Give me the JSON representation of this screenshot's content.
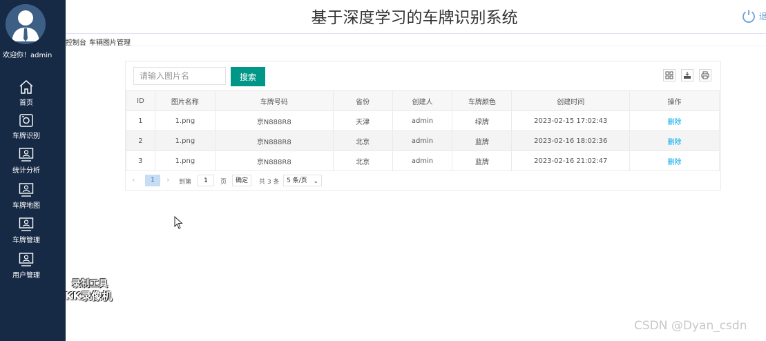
{
  "app": {
    "title": "基于深度学习的车牌识别系统",
    "welcome": "欢迎你！admin",
    "logout_text": "退"
  },
  "sidebar": {
    "items": [
      {
        "label": "首页",
        "icon": "home-icon"
      },
      {
        "label": "车牌识别",
        "icon": "camera-icon"
      },
      {
        "label": "统计分析",
        "icon": "monitor-user-icon"
      },
      {
        "label": "车牌地图",
        "icon": "monitor-user-icon"
      },
      {
        "label": "车牌管理",
        "icon": "monitor-user-icon"
      },
      {
        "label": "用户管理",
        "icon": "monitor-user-icon"
      }
    ]
  },
  "breadcrumb": [
    "控制台",
    "车辆图片管理"
  ],
  "search": {
    "placeholder": "请输入图片名",
    "button": "搜索"
  },
  "toolbar": [
    "columns-icon",
    "export-icon",
    "print-icon"
  ],
  "table": {
    "columns": [
      "ID",
      "图片名称",
      "车牌号码",
      "省份",
      "创建人",
      "车牌颜色",
      "创建时间",
      "操作"
    ],
    "rows": [
      {
        "id": "1",
        "name": "1.png",
        "plate": "京N888R8",
        "province": "天津",
        "creator": "admin",
        "color": "绿牌",
        "time": "2023-02-15 17:02:43",
        "action": "删除"
      },
      {
        "id": "2",
        "name": "1.png",
        "plate": "京N888R8",
        "province": "北京",
        "creator": "admin",
        "color": "蓝牌",
        "time": "2023-02-16 18:02:36",
        "action": "删除"
      },
      {
        "id": "3",
        "name": "1.png",
        "plate": "京N888R8",
        "province": "北京",
        "creator": "admin",
        "color": "蓝牌",
        "time": "2023-02-16 21:02:47",
        "action": "删除"
      }
    ]
  },
  "pagination": {
    "current": "1",
    "goto_label": "到第",
    "goto_value": "1",
    "page_label": "页",
    "confirm": "确定",
    "total": "共 3 条",
    "page_size": "5 条/页"
  },
  "watermarks": {
    "recorder_top": "录制工具",
    "recorder_bottom": "KK录像机",
    "csdn": "CSDN @Dyan_csdn"
  },
  "colors": {
    "sidebar_bg": "#172a45",
    "accent": "#009688",
    "link": "#01aaed"
  }
}
